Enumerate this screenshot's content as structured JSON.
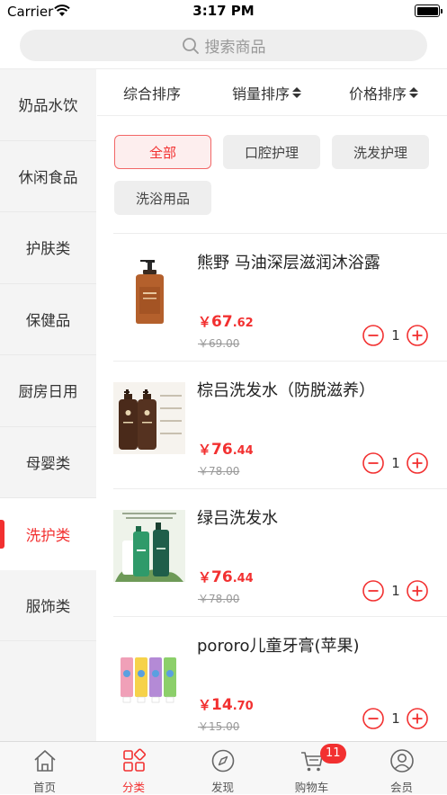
{
  "status_bar": {
    "carrier": "Carrier",
    "time": "3:17 PM"
  },
  "search": {
    "placeholder": "搜索商品"
  },
  "sidebar": {
    "items": [
      {
        "label": "奶品水饮",
        "active": false
      },
      {
        "label": "休闲食品",
        "active": false
      },
      {
        "label": "护肤类",
        "active": false
      },
      {
        "label": "保健品",
        "active": false
      },
      {
        "label": "厨房日用",
        "active": false
      },
      {
        "label": "母婴类",
        "active": false
      },
      {
        "label": "洗护类",
        "active": true
      },
      {
        "label": "服饰类",
        "active": false
      }
    ]
  },
  "sort": {
    "comprehensive": "综合排序",
    "sales": "销量排序",
    "price": "价格排序"
  },
  "chips": [
    {
      "label": "全部",
      "active": true
    },
    {
      "label": "口腔护理",
      "active": false
    },
    {
      "label": "洗发护理",
      "active": false
    },
    {
      "label": "洗浴用品",
      "active": false
    }
  ],
  "products": [
    {
      "name": "熊野 马油深层滋润沐浴露",
      "currency": "￥",
      "price_int": "67",
      "price_dec": ".62",
      "old_price": "￥69.00",
      "qty": "1",
      "image": "amber-pump-bottle"
    },
    {
      "name": "棕吕洗发水（防脱滋养）",
      "currency": "￥",
      "price_int": "76",
      "price_dec": ".44",
      "old_price": "￥78.00",
      "qty": "1",
      "image": "two-brown-shampoo-bottles"
    },
    {
      "name": "绿吕洗发水",
      "currency": "￥",
      "price_int": "76",
      "price_dec": ".44",
      "old_price": "￥78.00",
      "qty": "1",
      "image": "green-shampoo-bottles"
    },
    {
      "name": "pororo儿童牙膏(苹果)",
      "currency": "￥",
      "price_int": "14",
      "price_dec": ".70",
      "old_price": "￥15.00",
      "qty": "1",
      "image": "kids-toothpaste-tubes"
    }
  ],
  "tabbar": {
    "tabs": [
      {
        "label": "首页",
        "icon": "home-icon",
        "active": false
      },
      {
        "label": "分类",
        "icon": "category-icon",
        "active": true
      },
      {
        "label": "发现",
        "icon": "compass-icon",
        "active": false
      },
      {
        "label": "购物车",
        "icon": "cart-icon",
        "active": false
      },
      {
        "label": "会员",
        "icon": "user-icon",
        "active": false
      }
    ],
    "cart_badge": "11"
  },
  "colors": {
    "accent": "#f23030",
    "sidebar_bg": "#f4f4f4",
    "chip_bg": "#eeeeee"
  }
}
